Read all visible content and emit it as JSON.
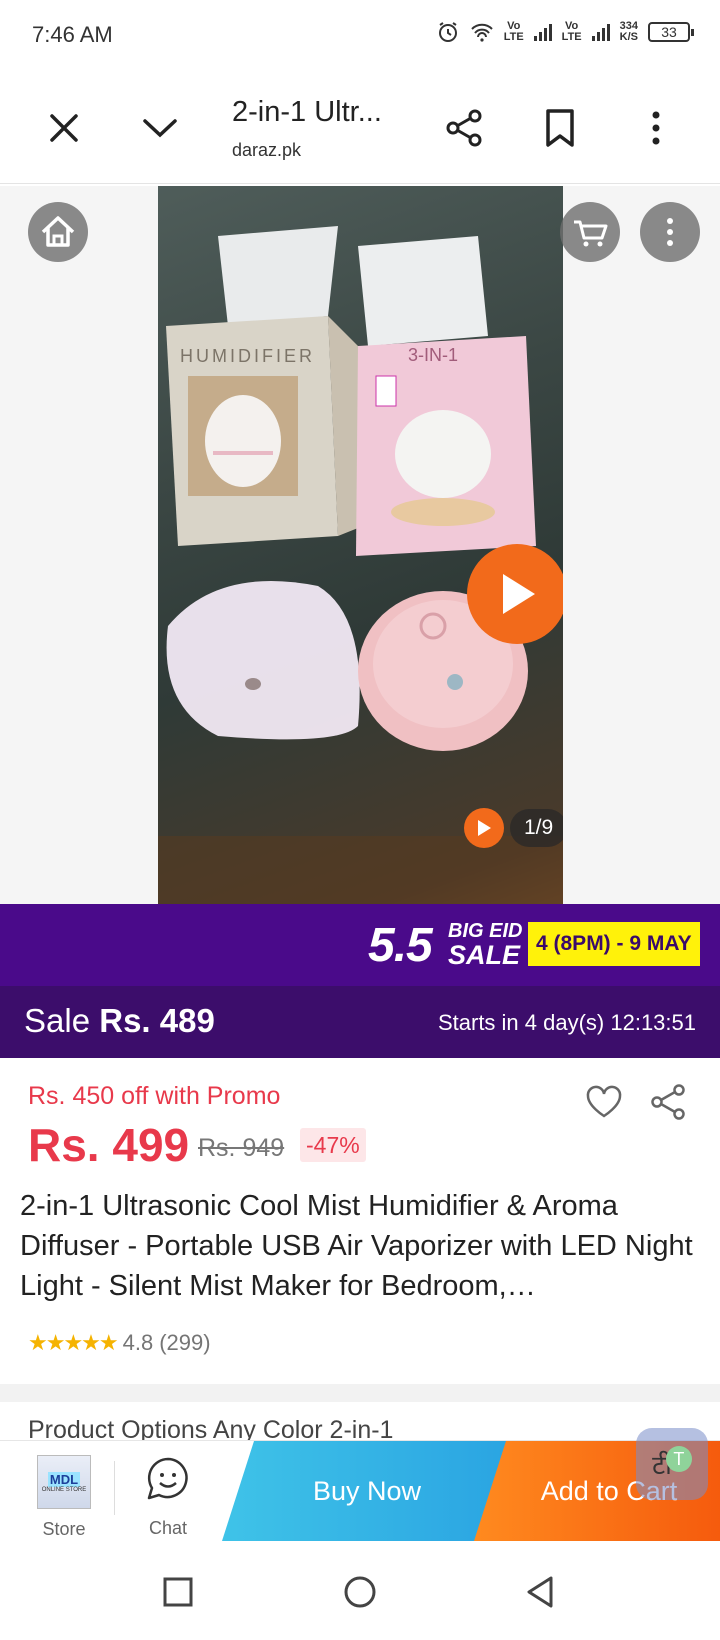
{
  "status_bar": {
    "time": "7:46 AM",
    "sim1": {
      "top": "Vo",
      "bottom": "LTE"
    },
    "sim2": {
      "top": "Vo",
      "bottom": "LTE"
    },
    "speed_value": "334",
    "speed_unit": "K/S",
    "battery": "33"
  },
  "browser": {
    "title": "2-in-1 Ultr...",
    "domain": "daraz.pk"
  },
  "gallery": {
    "counter": "1/9"
  },
  "promo_banner": {
    "event_number": "5.5",
    "event_line1": "BIG EID",
    "event_line2": "SALE",
    "dates": "4 (8PM) - 9 MAY",
    "background": "#4a0a8a",
    "date_badge_color": "#fff20a"
  },
  "sale": {
    "label": "Sale",
    "price": "Rs. 489",
    "countdown": "Starts in 4 day(s) 12:13:51"
  },
  "product": {
    "promo_text": "Rs. 450 off with Promo",
    "price": "Rs. 499",
    "original_price": "Rs. 949",
    "discount": "-47%",
    "title": "2-in-1 Ultrasonic Cool Mist Humidifier & Aroma Diffuser - Portable USB Air Vaporizer with LED Night Light - Silent Mist Maker for Bedroom,…",
    "rating": "4.8",
    "reviews": "(299)",
    "accent_color": "#e8394b"
  },
  "options_peek": "Product Options   Any Color 2-in-1",
  "actions": {
    "store_label": "Store",
    "store_logo_text": "MDL",
    "store_logo_tagline": "ONLINE STORE",
    "chat_label": "Chat",
    "buy_now": "Buy Now",
    "add_to_cart": "Add to Cart"
  },
  "translate_bubble": {
    "glyph1": "टी",
    "glyph2": "T"
  },
  "icons": {
    "close": "close-icon",
    "collapse": "chevron-down-icon",
    "share": "share-icon",
    "bookmark": "bookmark-icon",
    "more": "more-vertical-icon",
    "home": "home-icon",
    "cart": "cart-icon"
  }
}
